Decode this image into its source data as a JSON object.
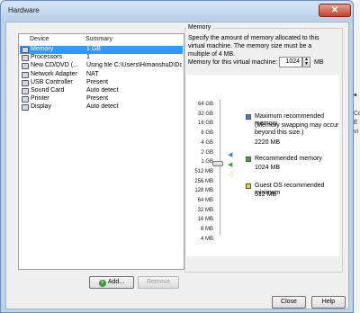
{
  "window": {
    "title": "Hardware",
    "close_glyph": "✕"
  },
  "devices": {
    "columns": [
      "Device",
      "Summary"
    ],
    "rows": [
      {
        "icon": "memory-icon",
        "name": "Memory",
        "summary": "1 GB",
        "selected": true
      },
      {
        "icon": "processor-icon",
        "name": "Processors",
        "summary": "1",
        "selected": false
      },
      {
        "icon": "cd-dvd-icon",
        "name": "New CD/DVD (...",
        "summary": "Using file C:\\Users\\HimanshuD\\Do...",
        "selected": false
      },
      {
        "icon": "network-adapter-icon",
        "name": "Network Adapter",
        "summary": "NAT",
        "selected": false
      },
      {
        "icon": "usb-icon",
        "name": "USB Controller",
        "summary": "Present",
        "selected": false
      },
      {
        "icon": "sound-card-icon",
        "name": "Sound Card",
        "summary": "Auto detect",
        "selected": false
      },
      {
        "icon": "printer-icon",
        "name": "Printer",
        "summary": "Present",
        "selected": false
      },
      {
        "icon": "display-icon",
        "name": "Display",
        "summary": "Auto detect",
        "selected": false
      }
    ]
  },
  "buttons": {
    "add": "Add...",
    "remove": "Remove",
    "close": "Close",
    "help": "Help"
  },
  "memory": {
    "group_label": "Memory",
    "description": "Specify the amount of memory allocated to this virtual machine. The memory size must be a multiple of 4 MB.",
    "field_label": "Memory for this virtual machine:",
    "value": "1024",
    "unit": "MB",
    "scale_ticks": [
      "64 GB",
      "32 GB",
      "16 GB",
      "8 GB",
      "4 GB",
      "2 GB",
      "1 GB",
      "512 MB",
      "256 MB",
      "128 MB",
      "64 MB",
      "32 MB",
      "16 MB",
      "8 MB",
      "4 MB"
    ],
    "legend": [
      {
        "color": "#4a7fc1",
        "label": "Maximum recommended memory",
        "note": "(Memory swapping may occur beyond this size.)",
        "value": "2220 MB"
      },
      {
        "color": "#3aa63a",
        "label": "Recommended memory",
        "note": "",
        "value": "1024 MB"
      },
      {
        "color": "#e8d040",
        "label": "Guest OS recommended minimum",
        "note": "",
        "value": "512 MB"
      }
    ]
  },
  "background": {
    "snippets": [
      "•",
      "Co",
      "E",
      "vi"
    ]
  }
}
